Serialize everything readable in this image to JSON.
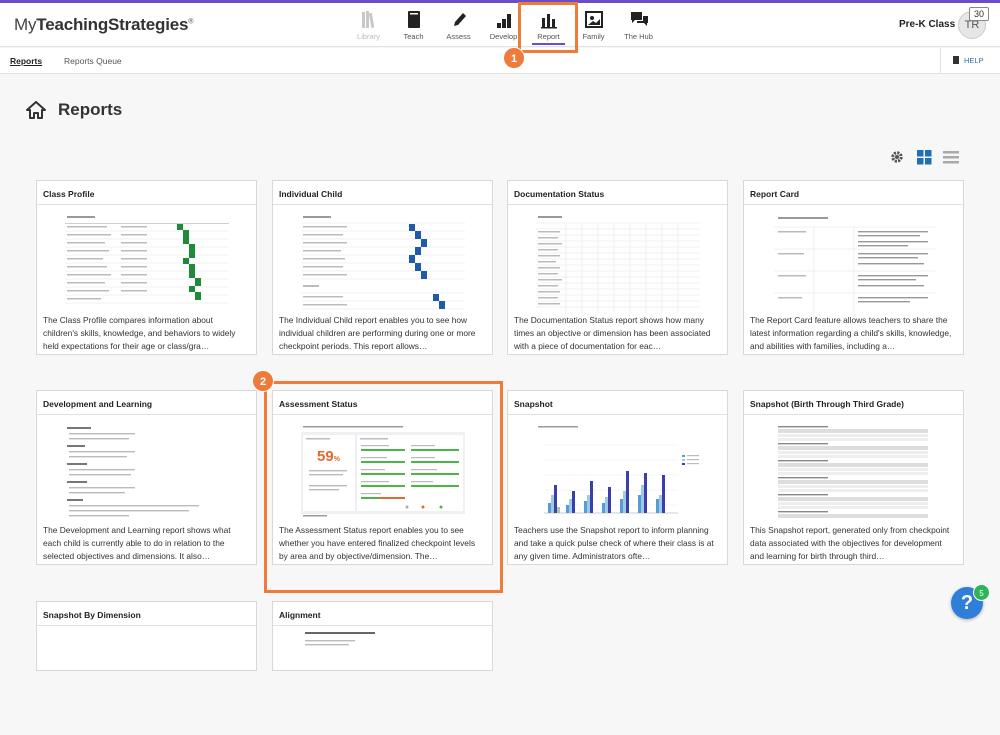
{
  "app": {
    "logo_light": "My",
    "logo_bold": "TeachingStrategies",
    "logo_mark": "®"
  },
  "nav": {
    "items": [
      {
        "label": "Library",
        "icon": "books-icon"
      },
      {
        "label": "Teach",
        "icon": "book-icon"
      },
      {
        "label": "Assess",
        "icon": "pencil-icon"
      },
      {
        "label": "Develop",
        "icon": "stairs-icon"
      },
      {
        "label": "Report",
        "icon": "bar-chart-icon"
      },
      {
        "label": "Family",
        "icon": "photo-frame-icon"
      },
      {
        "label": "The Hub",
        "icon": "chat-bubbles-icon"
      }
    ],
    "active": "Report"
  },
  "user": {
    "class_name": "Pre-K Class",
    "initials": "TR",
    "badge": "30"
  },
  "subnav": {
    "tabs": [
      "Reports",
      "Reports Queue"
    ],
    "help": "HELP"
  },
  "page": {
    "title": "Reports"
  },
  "cards": [
    {
      "title": "Class Profile",
      "desc": "The Class Profile compares information about children's skills, knowledge, and behaviors to widely held expectations for their age or class/gra…"
    },
    {
      "title": "Individual Child",
      "desc": "The Individual Child report enables you to see how individual children are performing during one or more checkpoint periods. This report allows…"
    },
    {
      "title": "Documentation Status",
      "desc": "The Documentation Status report shows how many times an objective or dimension has been associated with a piece of documentation for eac…"
    },
    {
      "title": "Report Card",
      "desc": "The Report Card feature allows teachers to share the latest information regarding a child's skills, knowledge, and abilities with families, including a…"
    },
    {
      "title": "Development and Learning",
      "desc": "The Development and Learning report shows what each child is currently able to do in relation to the selected objectives and dimensions. It also…"
    },
    {
      "title": "Assessment Status",
      "desc": "The Assessment Status report enables you to see whether you have entered finalized checkpoint levels by area and by objective/dimension. The…"
    },
    {
      "title": "Snapshot",
      "desc": "Teachers use the Snapshot report to inform planning and take a quick pulse check of where their class is at any given time. Administrators ofte…"
    },
    {
      "title": "Snapshot (Birth Through Third Grade)",
      "desc": "This Snapshot report, generated only from checkpoint data associated with the objectives for development and learning for birth through third…"
    },
    {
      "title": "Snapshot By Dimension",
      "desc": ""
    },
    {
      "title": "Alignment",
      "desc": ""
    }
  ],
  "thumbs": {
    "assessment_percent": "59",
    "assessment_percent_sign": "%"
  },
  "callouts": [
    "1",
    "2"
  ],
  "help_fab": {
    "glyph": "?",
    "badge": "5"
  },
  "colors": {
    "accent": "#6b4cc9",
    "callout": "#ef7b3a",
    "link": "#2b6cb0",
    "fab": "#2f7fd8",
    "fab_badge": "#2fb359"
  }
}
